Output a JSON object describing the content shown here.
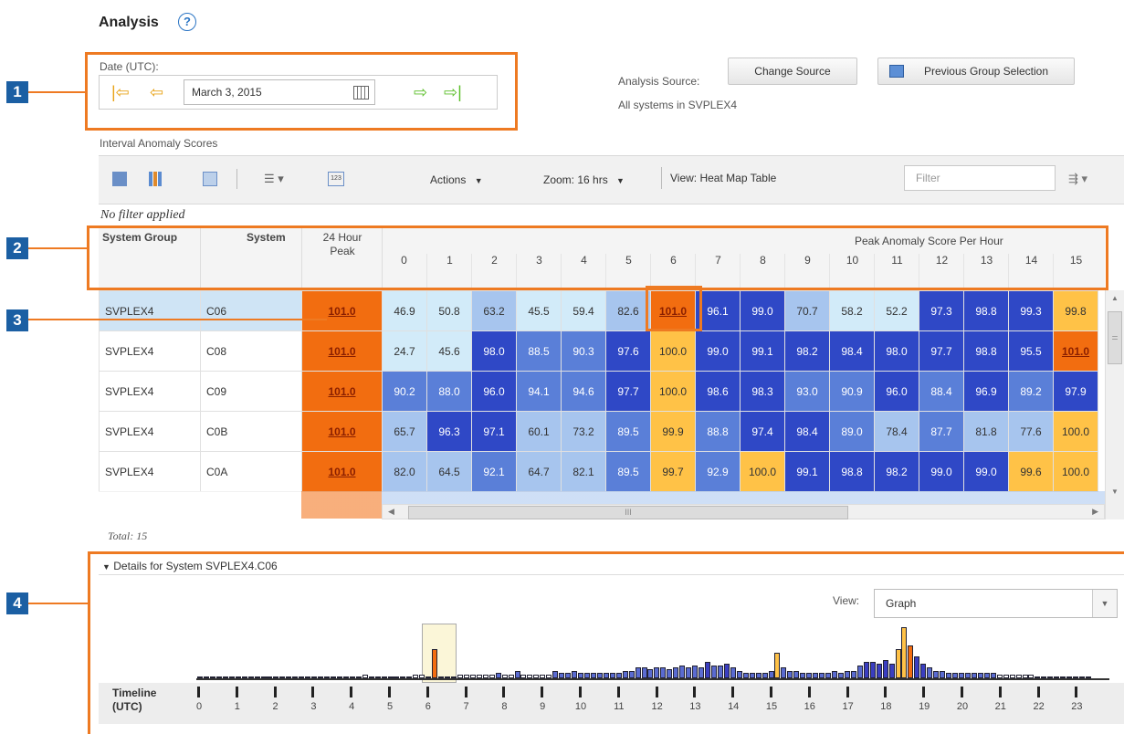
{
  "title": "Analysis",
  "help_glyph": "?",
  "callouts": [
    "1",
    "2",
    "3",
    "4"
  ],
  "date_panel": {
    "label": "Date (UTC):",
    "date_value": "March 3, 2015"
  },
  "analysis_source": {
    "label": "Analysis Source:",
    "value": "All systems in SVPLEX4",
    "change_button": "Change Source",
    "previous_button": "Previous Group Selection"
  },
  "section_label": "Interval Anomaly Scores",
  "toolbar": {
    "actions": "Actions",
    "zoom": "Zoom: 16 hrs",
    "view": "View: Heat Map Table",
    "filter_placeholder": "Filter"
  },
  "filter_status": "No filter applied",
  "table": {
    "headers": {
      "group": "System Group",
      "system": "System",
      "peak": "24 Hour Peak",
      "per_hour": "Peak Anomaly Score Per Hour"
    },
    "hours": [
      "0",
      "1",
      "2",
      "3",
      "4",
      "5",
      "6",
      "7",
      "8",
      "9",
      "10",
      "11",
      "12",
      "13",
      "14",
      "15"
    ],
    "rows": [
      {
        "group": "SVPLEX4",
        "system": "C06",
        "peak": "101.0",
        "scores": [
          "46.9",
          "50.8",
          "63.2",
          "45.5",
          "59.4",
          "82.6",
          "101.0",
          "96.1",
          "99.0",
          "70.7",
          "58.2",
          "52.2",
          "97.3",
          "98.8",
          "99.3",
          "99.8"
        ]
      },
      {
        "group": "SVPLEX4",
        "system": "C08",
        "peak": "101.0",
        "scores": [
          "24.7",
          "45.6",
          "98.0",
          "88.5",
          "90.3",
          "97.6",
          "100.0",
          "99.0",
          "99.1",
          "98.2",
          "98.4",
          "98.0",
          "97.7",
          "98.8",
          "95.5",
          "101.0"
        ]
      },
      {
        "group": "SVPLEX4",
        "system": "C09",
        "peak": "101.0",
        "scores": [
          "90.2",
          "88.0",
          "96.0",
          "94.1",
          "94.6",
          "97.7",
          "100.0",
          "98.6",
          "98.3",
          "93.0",
          "90.9",
          "96.0",
          "88.4",
          "96.9",
          "89.2",
          "97.9"
        ]
      },
      {
        "group": "SVPLEX4",
        "system": "C0B",
        "peak": "101.0",
        "scores": [
          "65.7",
          "96.3",
          "97.1",
          "60.1",
          "73.2",
          "89.5",
          "99.9",
          "88.8",
          "97.4",
          "98.4",
          "89.0",
          "78.4",
          "87.7",
          "81.8",
          "77.6",
          "100.0"
        ]
      },
      {
        "group": "SVPLEX4",
        "system": "C0A",
        "peak": "101.0",
        "scores": [
          "82.0",
          "64.5",
          "92.1",
          "64.7",
          "82.1",
          "89.5",
          "99.7",
          "92.9",
          "100.0",
          "99.1",
          "98.8",
          "98.2",
          "99.0",
          "99.0",
          "99.6",
          "100.0"
        ]
      }
    ],
    "scroll_mark": "III",
    "total": "Total: 15"
  },
  "details": {
    "title": "Details for System SVPLEX4.C06",
    "view_label": "View:",
    "view_value": "Graph",
    "timeline_label": [
      "Timeline",
      "(UTC)"
    ],
    "timeline_hours": [
      "0",
      "1",
      "2",
      "3",
      "4",
      "5",
      "6",
      "7",
      "8",
      "9",
      "10",
      "11",
      "12",
      "13",
      "14",
      "15",
      "16",
      "17",
      "18",
      "19",
      "20",
      "21",
      "22",
      "23"
    ]
  },
  "colors": {
    "accent": "#ee7a22",
    "callout_blue": "#1b5fa3",
    "peak": "#f26d10",
    "very_high": "#2f48c6",
    "high": "#5a7fd8",
    "mid": "#a7c5ee",
    "low": "#d2ebf9",
    "hundred": "#ffc247",
    "selected_row": "#cfe4f5"
  }
}
